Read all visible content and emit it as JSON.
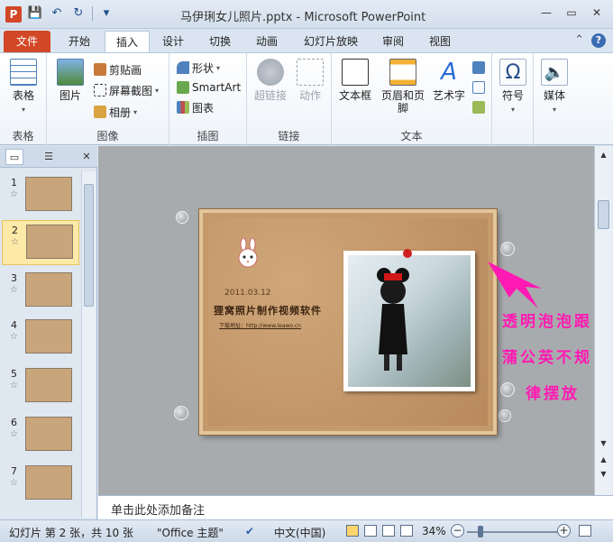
{
  "titlebar": {
    "app_icon": "P",
    "title": "马伊琍女儿照片.pptx - Microsoft PowerPoint",
    "qat": {
      "save_icon": "💾",
      "undo_icon": "↶",
      "redo_icon": "↻",
      "customize_icon": "▾"
    },
    "window_buttons": {
      "minimize": "—",
      "maximize": "▭",
      "close": "✕"
    }
  },
  "tabs": {
    "file": "文件",
    "home": "开始",
    "insert": "插入",
    "design": "设计",
    "transitions": "切换",
    "animations": "动画",
    "slideshow": "幻灯片放映",
    "review": "审阅",
    "view": "视图",
    "help": "?"
  },
  "ribbon": {
    "groups": {
      "tables": {
        "label": "表格",
        "table_button": "表格"
      },
      "images": {
        "label": "图像",
        "picture_button": "图片",
        "clipart": "剪贴画",
        "screenshot": "屏幕截图",
        "album": "相册"
      },
      "illustrations": {
        "label": "插图",
        "shapes": "形状",
        "smartart": "SmartArt",
        "chart": "图表"
      },
      "links": {
        "label": "链接",
        "hyperlink": "超链接",
        "action": "动作"
      },
      "text": {
        "label": "文本",
        "textbox": "文本框",
        "header_footer": "页眉和页脚",
        "wordart": "艺术字"
      },
      "symbols": {
        "label": "",
        "symbol": "符号"
      },
      "media": {
        "label": "",
        "media": "媒体"
      }
    }
  },
  "slides_pane": {
    "slides": [
      {
        "num": "1"
      },
      {
        "num": "2"
      },
      {
        "num": "3"
      },
      {
        "num": "4"
      },
      {
        "num": "5"
      },
      {
        "num": "6"
      },
      {
        "num": "7"
      }
    ],
    "selected": "2"
  },
  "slide": {
    "date": "2011.03.12",
    "title": "狸窝照片制作视频软件",
    "link": "下载地址：http://www.leawo.cn"
  },
  "annotation": {
    "line1": "透明泡泡跟",
    "line2": "蒲公英不规",
    "line3": "律摆放",
    "color": "#ff1ab3"
  },
  "notes": {
    "placeholder": "单击此处添加备注"
  },
  "status": {
    "slide_info": "幻灯片 第 2 张，共 10 张",
    "theme": "\"Office 主题\"",
    "language": "中文(中国)",
    "zoom": "34%"
  }
}
